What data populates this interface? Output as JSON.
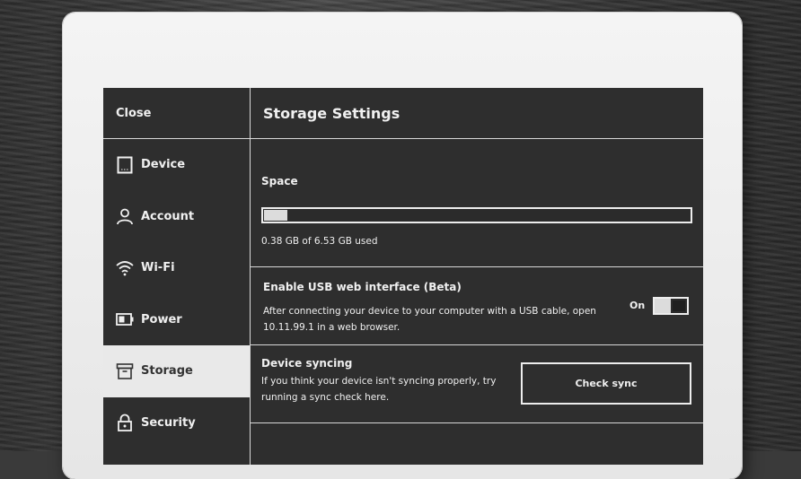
{
  "sidebar": {
    "close_label": "Close",
    "items": [
      {
        "label": "Device",
        "icon": "device-icon"
      },
      {
        "label": "Account",
        "icon": "account-icon"
      },
      {
        "label": "Wi-Fi",
        "icon": "wifi-icon"
      },
      {
        "label": "Power",
        "icon": "battery-icon"
      },
      {
        "label": "Storage",
        "icon": "storage-icon",
        "active": true
      },
      {
        "label": "Security",
        "icon": "lock-icon"
      }
    ]
  },
  "main": {
    "title": "Storage Settings",
    "space": {
      "label": "Space",
      "used_text": "0.38 GB of 6.53 GB used",
      "used_fraction": 0.058
    },
    "usb": {
      "heading": "Enable USB web interface (Beta)",
      "description": "After connecting your device to your computer with a USB cable, open 10.11.99.1 in a web browser.",
      "toggle_label": "On",
      "toggle_on": true
    },
    "sync": {
      "heading": "Device syncing",
      "description": "If you think your device isn't syncing properly, try running a sync check here.",
      "button_label": "Check sync"
    }
  },
  "colors": {
    "screen_bg": "#2e2e2e",
    "text": "#f0f0f0",
    "active_item_bg": "#e9e9e9",
    "device_frame": "#efefef"
  }
}
